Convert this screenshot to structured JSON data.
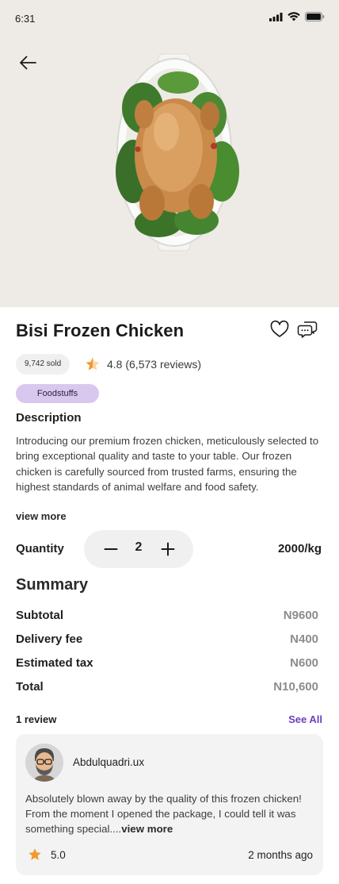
{
  "status_bar": {
    "time": "6:31"
  },
  "product": {
    "title": "Bisi Frozen Chicken",
    "sold": "9,742 sold",
    "rating": "4.8 (6,573 reviews)",
    "category": "Foodstuffs",
    "description_heading": "Description",
    "description": "Introducing our premium frozen chicken, meticulously selected to bring exceptional quality and taste to your table. Our frozen chicken is carefully sourced from trusted farms, ensuring the highest standards of animal welfare and food safety.",
    "view_more": "view more",
    "quantity_label": "Quantity",
    "quantity": "2",
    "unit_price": "2000/kg"
  },
  "summary": {
    "heading": "Summary",
    "rows": [
      {
        "label": "Subtotal",
        "value": "N9600"
      },
      {
        "label": "Delivery fee",
        "value": "N400"
      },
      {
        "label": "Estimated tax",
        "value": "N600"
      },
      {
        "label": "Total",
        "value": "N10,600"
      }
    ]
  },
  "reviews": {
    "count_label": "1 review",
    "see_all": "See All",
    "items": [
      {
        "name": "Abdulquadri.ux",
        "text": "Absolutely blown away by the quality of this frozen chicken! From the moment I opened the package, I could tell it was something special....",
        "more": "view more",
        "rating": "5.0",
        "time": "2 months ago"
      }
    ]
  },
  "icons": {
    "back": "arrow-left-icon",
    "favorite": "heart-icon",
    "chat": "chat-bubbles-icon",
    "star": "star-icon"
  },
  "colors": {
    "hero_bg": "#eeebe6",
    "chip_bg": "#d9c8ee",
    "accent_link": "#6b3fc0",
    "star": "#f29a2e",
    "muted_value": "#8c8c8c"
  }
}
